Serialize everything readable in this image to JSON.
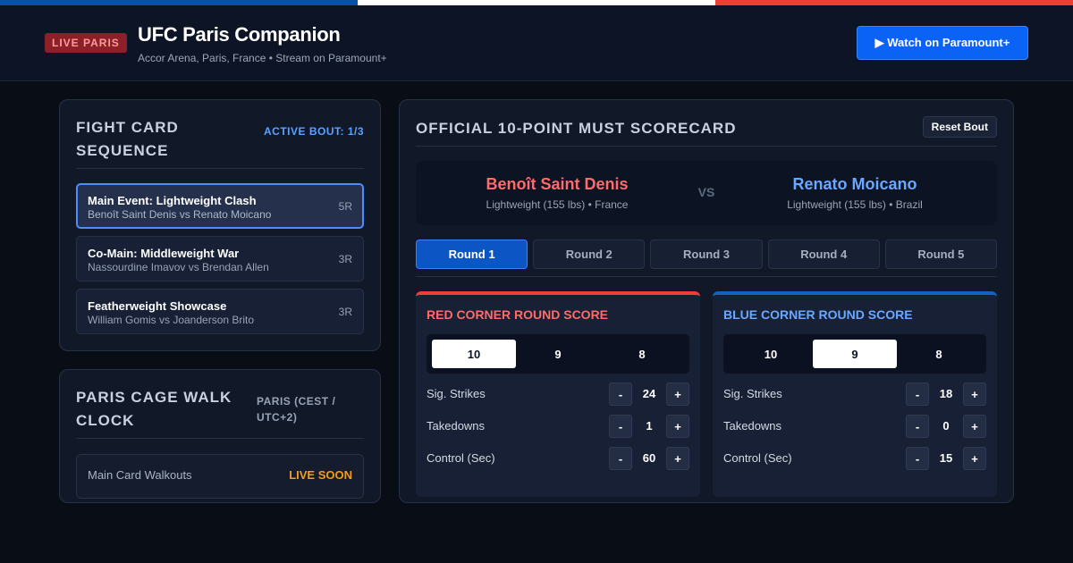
{
  "colors": {
    "flag_blue": "#0a4fa0",
    "flag_white": "#ffffff",
    "flag_red": "#ef3e3a",
    "accent": "#0b63f6",
    "red_corner": "#ff6b6b",
    "blue_corner": "#6aa8ff",
    "live_soon": "#f39c1f"
  },
  "header": {
    "badge": "LIVE PARIS",
    "title": "UFC Paris Companion",
    "subtitle": "Accor Arena, Paris, France • Stream on Paramount+",
    "watch_button": "▶ Watch on Paramount+"
  },
  "fight_card": {
    "title": "FIGHT CARD SEQUENCE",
    "active_label": "ACTIVE BOUT: 1/3",
    "bouts": [
      {
        "title": "Main Event: Lightweight Clash",
        "fighters": "Benoît Saint Denis vs Renato Moicano",
        "rounds": "5R",
        "active": true
      },
      {
        "title": "Co-Main: Middleweight War",
        "fighters": "Nassourdine Imavov vs Brendan Allen",
        "rounds": "3R",
        "active": false
      },
      {
        "title": "Featherweight Showcase",
        "fighters": "William Gomis vs Joanderson Brito",
        "rounds": "3R",
        "active": false
      }
    ]
  },
  "clock": {
    "title": "PARIS CAGE WALK CLOCK",
    "timezone": "PARIS (CEST / UTC+2)",
    "rows": [
      {
        "label": "Main Card Walkouts",
        "status": "LIVE SOON"
      }
    ]
  },
  "scorecard": {
    "title": "OFFICIAL 10-POINT MUST SCORECARD",
    "reset_button": "Reset Bout",
    "vs": "VS",
    "red_fighter": {
      "name": "Benoît Saint Denis",
      "info": "Lightweight (155 lbs) • France"
    },
    "blue_fighter": {
      "name": "Renato Moicano",
      "info": "Lightweight (155 lbs) • Brazil"
    },
    "rounds": [
      "Round 1",
      "Round 2",
      "Round 3",
      "Round 4",
      "Round 5"
    ],
    "active_round": 0,
    "score_options": [
      "10",
      "9",
      "8"
    ],
    "red_corner": {
      "title": "RED CORNER ROUND SCORE",
      "selected_score": "10",
      "stats": [
        {
          "label": "Sig. Strikes",
          "value": "24"
        },
        {
          "label": "Takedowns",
          "value": "1"
        },
        {
          "label": "Control (Sec)",
          "value": "60"
        }
      ]
    },
    "blue_corner": {
      "title": "BLUE CORNER ROUND SCORE",
      "selected_score": "9",
      "stats": [
        {
          "label": "Sig. Strikes",
          "value": "18"
        },
        {
          "label": "Takedowns",
          "value": "0"
        },
        {
          "label": "Control (Sec)",
          "value": "15"
        }
      ]
    },
    "stepper": {
      "minus": "-",
      "plus": "+"
    }
  }
}
